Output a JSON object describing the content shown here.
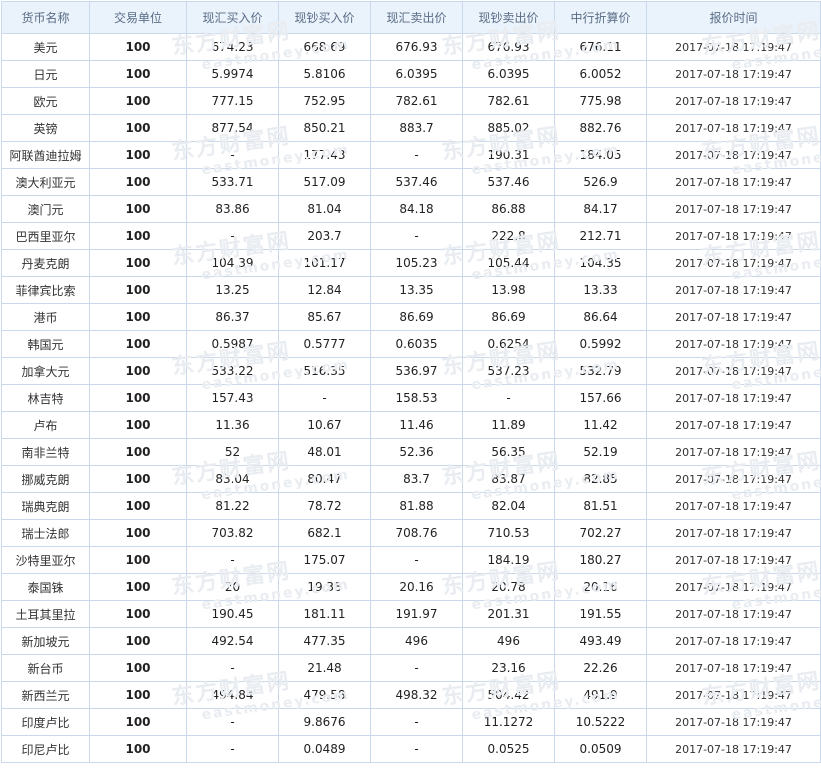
{
  "columns": [
    "货币名称",
    "交易单位",
    "现汇买入价",
    "现钞买入价",
    "现汇卖出价",
    "现钞卖出价",
    "中行折算价",
    "报价时间"
  ],
  "rows": [
    [
      "美元",
      "100",
      "674.23",
      "668.69",
      "676.93",
      "676.93",
      "676.11",
      "2017-07-18 17:19:47"
    ],
    [
      "日元",
      "100",
      "5.9974",
      "5.8106",
      "6.0395",
      "6.0395",
      "6.0052",
      "2017-07-18 17:19:47"
    ],
    [
      "欧元",
      "100",
      "777.15",
      "752.95",
      "782.61",
      "782.61",
      "775.98",
      "2017-07-18 17:19:47"
    ],
    [
      "英镑",
      "100",
      "877.54",
      "850.21",
      "883.7",
      "885.02",
      "882.76",
      "2017-07-18 17:19:47"
    ],
    [
      "阿联酋迪拉姆",
      "100",
      "-",
      "177.43",
      "-",
      "190.31",
      "184.05",
      "2017-07-18 17:19:47"
    ],
    [
      "澳大利亚元",
      "100",
      "533.71",
      "517.09",
      "537.46",
      "537.46",
      "526.9",
      "2017-07-18 17:19:47"
    ],
    [
      "澳门元",
      "100",
      "83.86",
      "81.04",
      "84.18",
      "86.88",
      "84.17",
      "2017-07-18 17:19:47"
    ],
    [
      "巴西里亚尔",
      "100",
      "-",
      "203.7",
      "-",
      "222.8",
      "212.71",
      "2017-07-18 17:19:47"
    ],
    [
      "丹麦克朗",
      "100",
      "104.39",
      "101.17",
      "105.23",
      "105.44",
      "104.35",
      "2017-07-18 17:19:47"
    ],
    [
      "菲律宾比索",
      "100",
      "13.25",
      "12.84",
      "13.35",
      "13.98",
      "13.33",
      "2017-07-18 17:19:47"
    ],
    [
      "港币",
      "100",
      "86.37",
      "85.67",
      "86.69",
      "86.69",
      "86.64",
      "2017-07-18 17:19:47"
    ],
    [
      "韩国元",
      "100",
      "0.5987",
      "0.5777",
      "0.6035",
      "0.6254",
      "0.5992",
      "2017-07-18 17:19:47"
    ],
    [
      "加拿大元",
      "100",
      "533.22",
      "516.35",
      "536.97",
      "537.23",
      "532.79",
      "2017-07-18 17:19:47"
    ],
    [
      "林吉特",
      "100",
      "157.43",
      "-",
      "158.53",
      "-",
      "157.66",
      "2017-07-18 17:19:47"
    ],
    [
      "卢布",
      "100",
      "11.36",
      "10.67",
      "11.46",
      "11.89",
      "11.42",
      "2017-07-18 17:19:47"
    ],
    [
      "南非兰特",
      "100",
      "52",
      "48.01",
      "52.36",
      "56.35",
      "52.19",
      "2017-07-18 17:19:47"
    ],
    [
      "挪威克朗",
      "100",
      "83.04",
      "80.47",
      "83.7",
      "83.87",
      "82.85",
      "2017-07-18 17:19:47"
    ],
    [
      "瑞典克朗",
      "100",
      "81.22",
      "78.72",
      "81.88",
      "82.04",
      "81.51",
      "2017-07-18 17:19:47"
    ],
    [
      "瑞士法郎",
      "100",
      "703.82",
      "682.1",
      "708.76",
      "710.53",
      "702.27",
      "2017-07-18 17:19:47"
    ],
    [
      "沙特里亚尔",
      "100",
      "-",
      "175.07",
      "-",
      "184.19",
      "180.27",
      "2017-07-18 17:19:47"
    ],
    [
      "泰国铢",
      "100",
      "20",
      "19.38",
      "20.16",
      "20.78",
      "20.16",
      "2017-07-18 17:19:47"
    ],
    [
      "土耳其里拉",
      "100",
      "190.45",
      "181.11",
      "191.97",
      "201.31",
      "191.55",
      "2017-07-18 17:19:47"
    ],
    [
      "新加坡元",
      "100",
      "492.54",
      "477.35",
      "496",
      "496",
      "493.49",
      "2017-07-18 17:19:47"
    ],
    [
      "新台币",
      "100",
      "-",
      "21.48",
      "-",
      "23.16",
      "22.26",
      "2017-07-18 17:19:47"
    ],
    [
      "新西兰元",
      "100",
      "494.84",
      "479.58",
      "498.32",
      "504.42",
      "491.9",
      "2017-07-18 17:19:47"
    ],
    [
      "印度卢比",
      "100",
      "-",
      "9.8676",
      "-",
      "11.1272",
      "10.5222",
      "2017-07-18 17:19:47"
    ],
    [
      "印尼卢比",
      "100",
      "-",
      "0.0489",
      "-",
      "0.0525",
      "0.0509",
      "2017-07-18 17:19:47"
    ]
  ],
  "watermark": {
    "brand": "东方财富网",
    "domain": "eastmoney.com"
  },
  "colors": {
    "header_bg": "#eaf2fb",
    "border": "#c9d8ea",
    "watermark": "#e9edf1"
  }
}
